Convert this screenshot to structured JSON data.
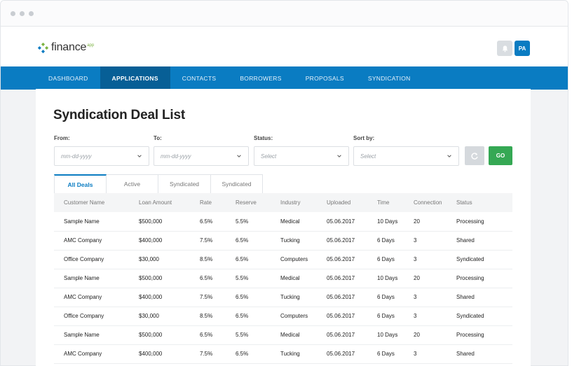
{
  "app": {
    "logo_text": "finance",
    "logo_sub": "app",
    "avatar_initials": "PA"
  },
  "nav": [
    {
      "label": "DASHBOARD",
      "active": false
    },
    {
      "label": "APPLICATIONS",
      "active": true
    },
    {
      "label": "CONTACTS",
      "active": false
    },
    {
      "label": "BORROWERS",
      "active": false
    },
    {
      "label": "PROPOSALS",
      "active": false
    },
    {
      "label": "SYNDICATION",
      "active": false
    }
  ],
  "page": {
    "title": "Syndication Deal List"
  },
  "filters": {
    "from": {
      "label": "From:",
      "placeholder": "mm-dd-yyyy"
    },
    "to": {
      "label": "To:",
      "placeholder": "mm-dd-yyyy"
    },
    "status": {
      "label": "Status:",
      "placeholder": "Select"
    },
    "sort": {
      "label": "Sort by:",
      "placeholder": "Select"
    },
    "go_label": "GO"
  },
  "tabs": [
    "All Deals",
    "Active",
    "Syndicated",
    "Syndicated"
  ],
  "table": {
    "headers": [
      "Customer Name",
      "Loan Amount",
      "Rate",
      "Reserve",
      "Industry",
      "Uploaded",
      "Time",
      "Connection",
      "Status"
    ],
    "rows": [
      [
        "Sample Name",
        "$500,000",
        "6.5%",
        "5.5%",
        "Medical",
        "05.06.2017",
        "10 Days",
        "20",
        "Processing"
      ],
      [
        "AMC Company",
        "$400,000",
        "7.5%",
        "6.5%",
        "Tucking",
        "05.06.2017",
        "6 Days",
        "3",
        "Shared"
      ],
      [
        "Office Company",
        "$30,000",
        "8.5%",
        "6.5%",
        "Computers",
        "05.06.2017",
        "6 Days",
        "3",
        "Syndicated"
      ],
      [
        "Sample Name",
        "$500,000",
        "6.5%",
        "5.5%",
        "Medical",
        "05.06.2017",
        "10 Days",
        "20",
        "Processing"
      ],
      [
        "AMC Company",
        "$400,000",
        "7.5%",
        "6.5%",
        "Tucking",
        "05.06.2017",
        "6 Days",
        "3",
        "Shared"
      ],
      [
        "Office Company",
        "$30,000",
        "8.5%",
        "6.5%",
        "Computers",
        "05.06.2017",
        "6 Days",
        "3",
        "Syndicated"
      ],
      [
        "Sample Name",
        "$500,000",
        "6.5%",
        "5.5%",
        "Medical",
        "05.06.2017",
        "10 Days",
        "20",
        "Processing"
      ],
      [
        "AMC Company",
        "$400,000",
        "7.5%",
        "6.5%",
        "Tucking",
        "05.06.2017",
        "6 Days",
        "3",
        "Shared"
      ]
    ]
  },
  "colors": {
    "brand_blue": "#0a7cc2",
    "nav_active": "#075f96",
    "go_green": "#35a854",
    "logo_green": "#7cb342"
  },
  "icons": [
    "logo-mark-icon",
    "bell-icon",
    "chevron-down-icon",
    "refresh-icon"
  ]
}
